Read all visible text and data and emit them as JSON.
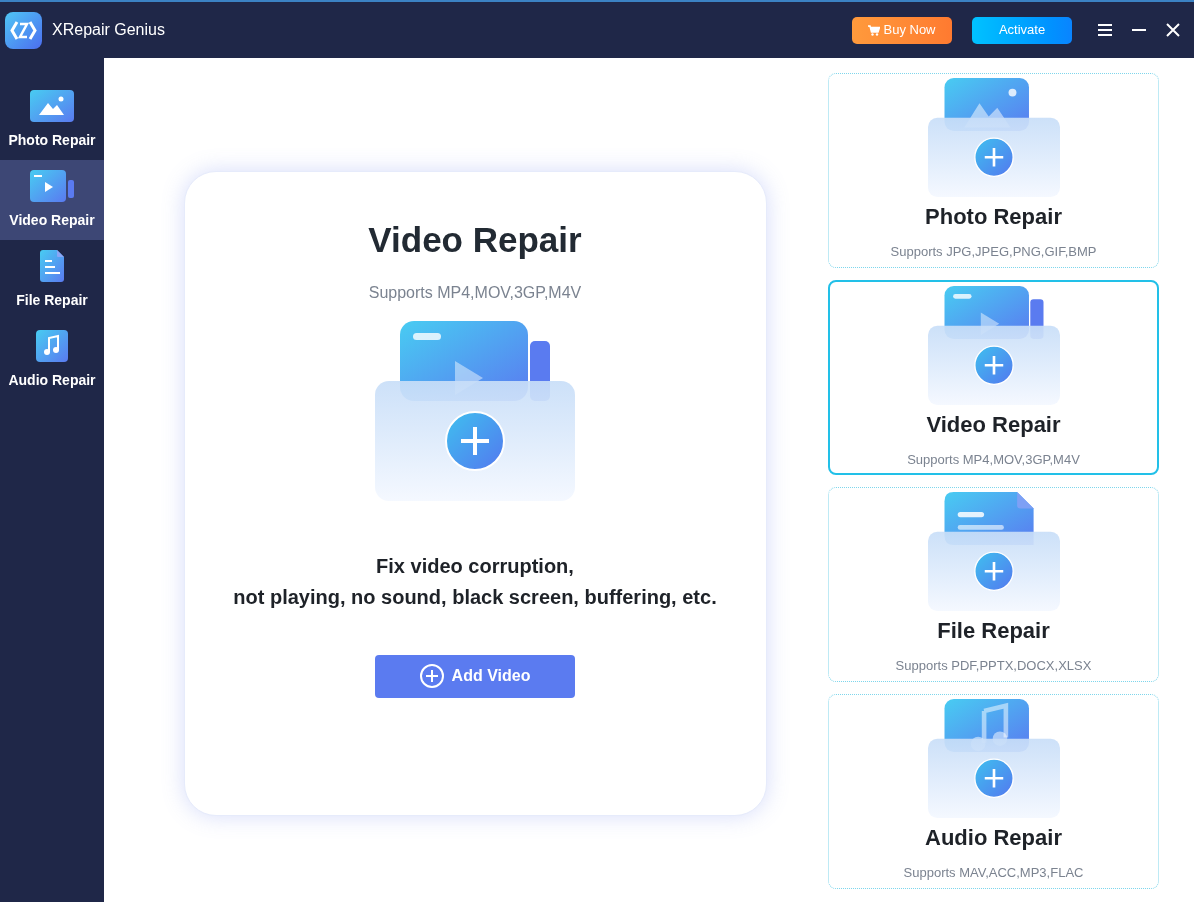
{
  "window": {
    "title": "XRepair Genius"
  },
  "header_buttons": [
    {
      "kind": "buy",
      "label": "Buy Now"
    },
    {
      "kind": "activate",
      "label": "Activate"
    }
  ],
  "sidebar": {
    "items": [
      {
        "kind": "photo",
        "label": "Photo Repair",
        "selected": false
      },
      {
        "kind": "video",
        "label": "Video Repair",
        "selected": true
      },
      {
        "kind": "file",
        "label": "File Repair",
        "selected": false
      },
      {
        "kind": "audio",
        "label": "Audio Repair",
        "selected": false
      }
    ]
  },
  "main_panel": {
    "kind": "video",
    "title": "Video Repair",
    "subtitle": "Supports MP4,MOV,3GP,M4V",
    "description": "Fix video corruption,\nnot playing, no sound, black screen, buffering, etc.",
    "button": "Add Video"
  },
  "cards": [
    {
      "kind": "photo",
      "title": "Photo Repair",
      "subtitle": "Supports JPG,JPEG,PNG,GIF,BMP",
      "selected": false
    },
    {
      "kind": "video",
      "title": "Video Repair",
      "subtitle": "Supports MP4,MOV,3GP,M4V",
      "selected": true
    },
    {
      "kind": "file",
      "title": "File Repair",
      "subtitle": "Supports PDF,PPTX,DOCX,XLSX",
      "selected": false
    },
    {
      "kind": "audio",
      "title": "Audio Repair",
      "subtitle": "Supports MAV,ACC,MP3,FLAC",
      "selected": false
    }
  ]
}
